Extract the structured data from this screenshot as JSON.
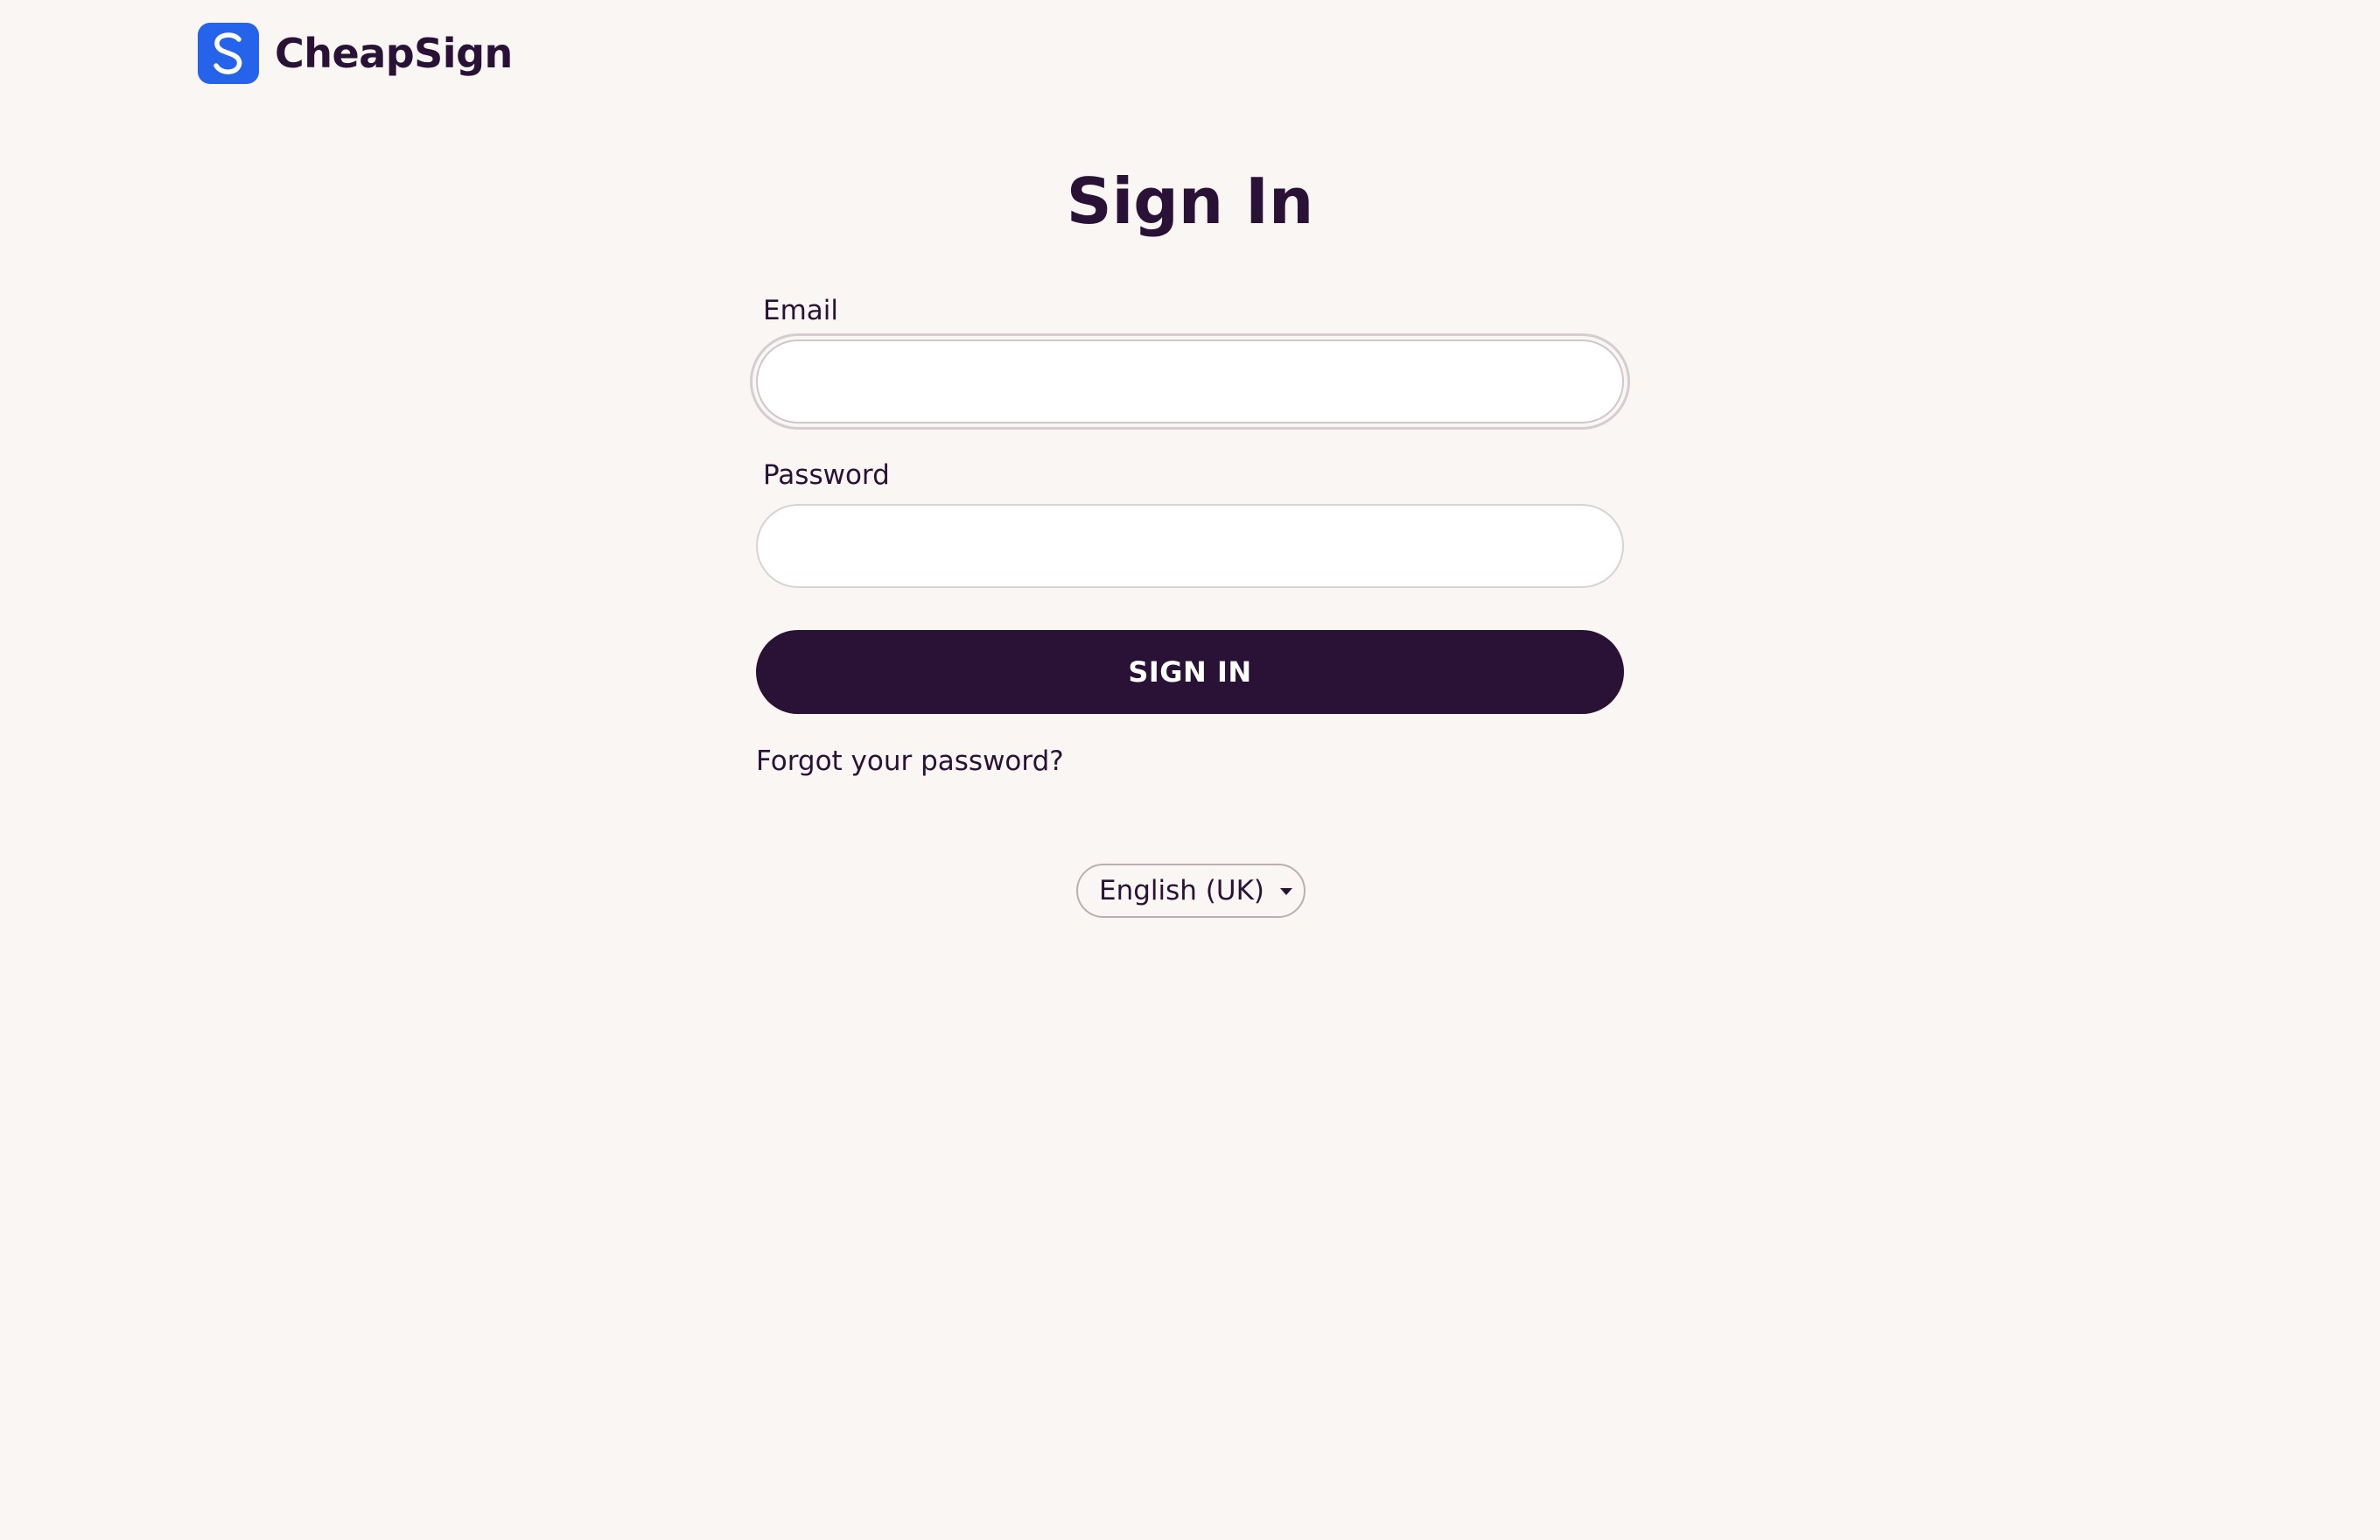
{
  "brand": {
    "name": "CheapSign",
    "mark_letter": "S",
    "mark_color": "#2563eb"
  },
  "form": {
    "title": "Sign In",
    "email_label": "Email",
    "email_value": "",
    "password_label": "Password",
    "password_value": "",
    "submit_label": "SIGN IN",
    "forgot_link": "Forgot your password?"
  },
  "language": {
    "selected": "English (UK)",
    "icon": "caret-down-icon"
  },
  "colors": {
    "background": "#faf6f3",
    "primary": "#2a1237",
    "accent": "#2563eb"
  }
}
